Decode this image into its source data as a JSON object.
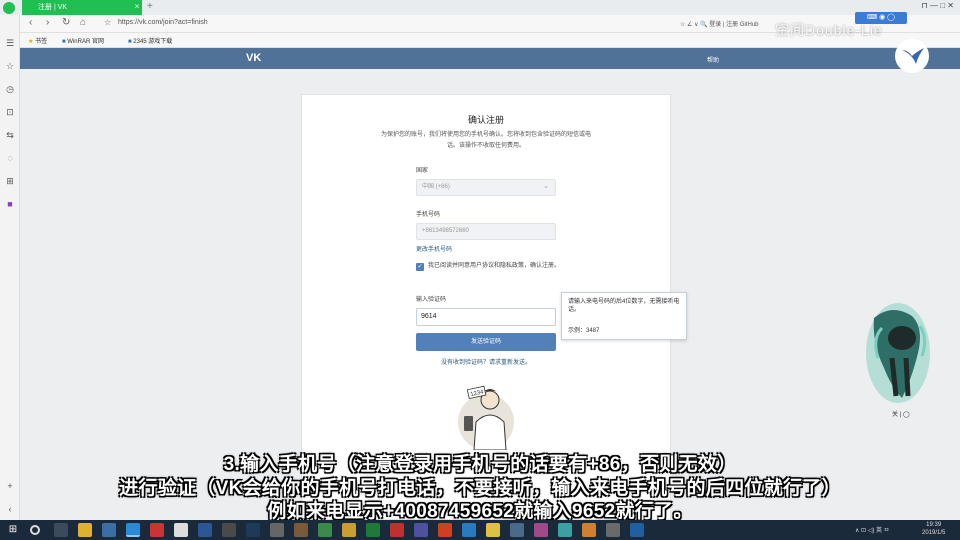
{
  "browser": {
    "tab_title": "注册 | VK",
    "tab_close": "×",
    "tab_add": "+",
    "url": "https://vk.com/join?act=finish",
    "addr_right": "☆  ∠  ∨   🔍 登录 | 注册 GitHub",
    "window_controls": "⊓   —   □   ✕",
    "bookmarks": [
      "书签",
      "WinRAR 官网",
      "2345 游戏下载"
    ]
  },
  "vk": {
    "logo": "VK",
    "help": "帮助",
    "title": "确认注册",
    "description": "为保护您的账号，我们将使用您的手机号确认。您将收到包含验证码的短信或电话。该操作不收取任何费用。",
    "country_label": "国家",
    "country_value": "中国 (+86)",
    "phone_label": "手机号码",
    "phone_value": "+8613498572660",
    "phone_change": "更改手机号码",
    "checkbox_text": "我已阅读并同意用户协议和隐私政策，确认注册。",
    "code_label": "输入验证码",
    "code_value": "9614",
    "confirm_button": "发送验证码",
    "resend_link": "没有收到验证码？请求重新发送。",
    "hint_text": "请输入来电号码的后4位数字，无需接听电话。",
    "hint_example": "示例：3487",
    "card_badge": "1234"
  },
  "overlay": {
    "watermark": "空间Double-Lie",
    "float_bar": "⌨ ◉ ◯",
    "mascot_label": "关 | ◯"
  },
  "subtitles": {
    "line1": "3.输入手机号（注意登录用手机号的话要有+86，否则无效）",
    "line2": "进行验证（VK会给你的手机号打电话，不要接听，输入来电手机号的后四位就行了）",
    "line3": "例如来电显示+40087459652就输入9652就行了。"
  },
  "taskbar": {
    "tray": "∧  ⊡  ◁)  英  ㅁ",
    "time": "19:39",
    "date": "2019/1/5"
  },
  "colors": {
    "vk_blue": "#507299",
    "vk_button": "#5181b8",
    "tab_green": "#1fbf52",
    "taskbar": "#1b2a3b"
  }
}
